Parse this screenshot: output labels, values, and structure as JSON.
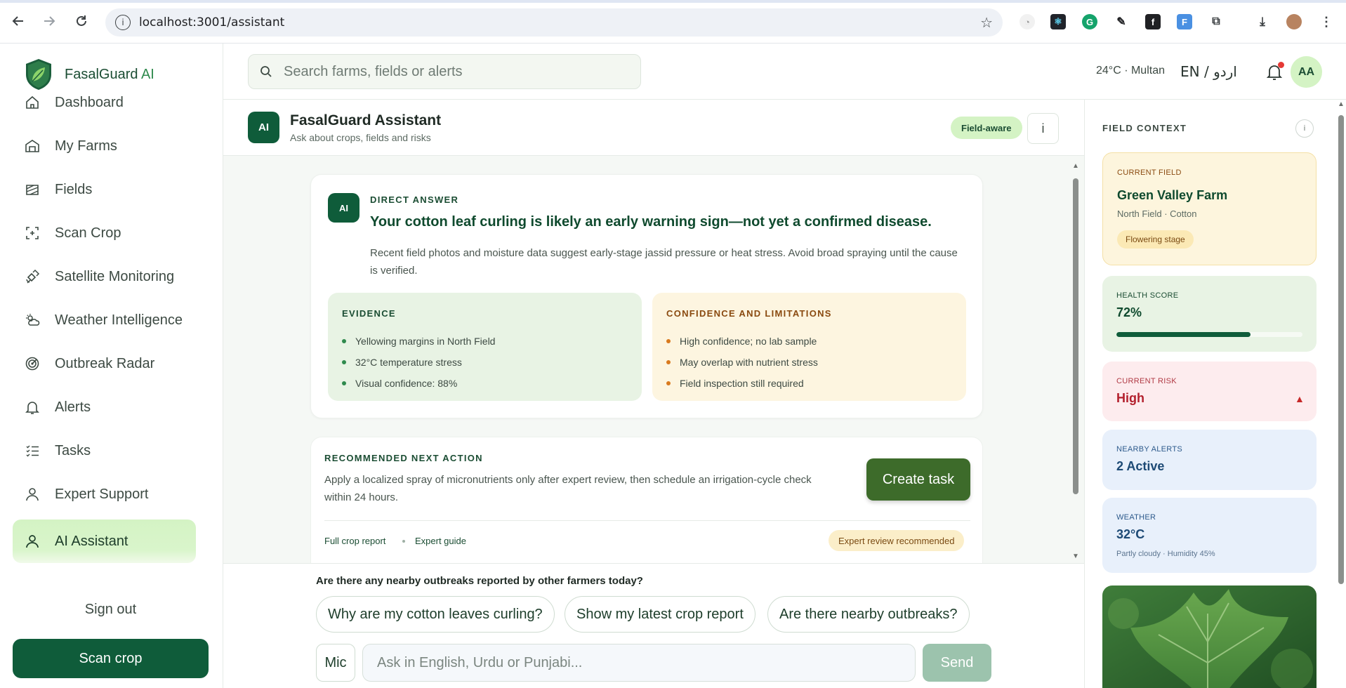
{
  "browser": {
    "url": "localhost:3001/assistant"
  },
  "brand": {
    "name": "FasalGuard",
    "ai": "AI"
  },
  "sidebar": {
    "items": [
      {
        "label": "Dashboard",
        "icon": "home-icon"
      },
      {
        "label": "My Farms",
        "icon": "barn-icon"
      },
      {
        "label": "Fields",
        "icon": "field-icon"
      },
      {
        "label": "Scan Crop",
        "icon": "scan-icon"
      },
      {
        "label": "Satellite Monitoring",
        "icon": "satellite-icon"
      },
      {
        "label": "Weather Intelligence",
        "icon": "weather-icon"
      },
      {
        "label": "Outbreak Radar",
        "icon": "radar-icon"
      },
      {
        "label": "Alerts",
        "icon": "bell-icon"
      },
      {
        "label": "Tasks",
        "icon": "list-icon"
      },
      {
        "label": "Expert Support",
        "icon": "user-icon"
      },
      {
        "label": "AI Assistant",
        "icon": "user-icon",
        "active": true
      }
    ],
    "sign_out": "Sign out",
    "scan_crop": "Scan crop"
  },
  "topbar": {
    "search_placeholder": "Search farms, fields or alerts",
    "weather": "24°C · Multan",
    "lang": "EN / اردو",
    "avatar": "AA"
  },
  "chat_header": {
    "badge": "AI",
    "title": "FasalGuard Assistant",
    "subtitle": "Ask about crops, fields and risks",
    "field_aware": "Field-aware",
    "info": "i"
  },
  "answer": {
    "badge": "AI",
    "label": "DIRECT ANSWER",
    "title": "Your cotton leaf curling is likely an early warning sign—not yet a confirmed disease.",
    "body": "Recent field photos and moisture data suggest early-stage jassid pressure or heat stress. Avoid broad spraying until the cause is verified.",
    "evidence": {
      "title": "EVIDENCE",
      "items": [
        "Yellowing margins in North Field",
        "32°C temperature stress",
        "Visual confidence: 88%"
      ]
    },
    "limits": {
      "title": "CONFIDENCE AND LIMITATIONS",
      "items": [
        "High confidence; no lab sample",
        "May overlap with nutrient stress",
        "Field inspection still required"
      ]
    }
  },
  "action": {
    "label": "RECOMMENDED NEXT ACTION",
    "text": "Apply a localized spray of micronutrients only after expert review, then schedule an irrigation-cycle check within 24 hours.",
    "create_task": "Create task",
    "link_report": "Full crop report",
    "link_guide": "Expert guide",
    "expert_pill": "Expert review recommended"
  },
  "composer": {
    "question": "Are there any nearby outbreaks reported by other farmers today?",
    "chips": [
      "Why are my cotton leaves curling?",
      "Show my latest crop report",
      "Are there nearby outbreaks?"
    ],
    "mic": "Mic",
    "input_placeholder": "Ask in English, Urdu or Punjabi...",
    "send": "Send"
  },
  "field_context": {
    "title": "FIELD CONTEXT",
    "info": "i",
    "current_field": {
      "caption": "CURRENT FIELD",
      "name": "Green Valley Farm",
      "sub": "North Field · Cotton",
      "stage": "Flowering stage"
    },
    "health": {
      "caption": "HEALTH SCORE",
      "value": "72%",
      "fraction": 0.72
    },
    "risk": {
      "caption": "CURRENT RISK",
      "value": "High"
    },
    "alerts": {
      "caption": "NEARBY ALERTS",
      "value": "2 Active"
    },
    "weather": {
      "caption": "WEATHER",
      "value": "32°C",
      "sub": "Partly cloudy · Humidity 45%"
    }
  },
  "colors": {
    "brand_green": "#0f5c3a",
    "accent_light": "#d4f3c4",
    "risk_red": "#b3202d"
  }
}
